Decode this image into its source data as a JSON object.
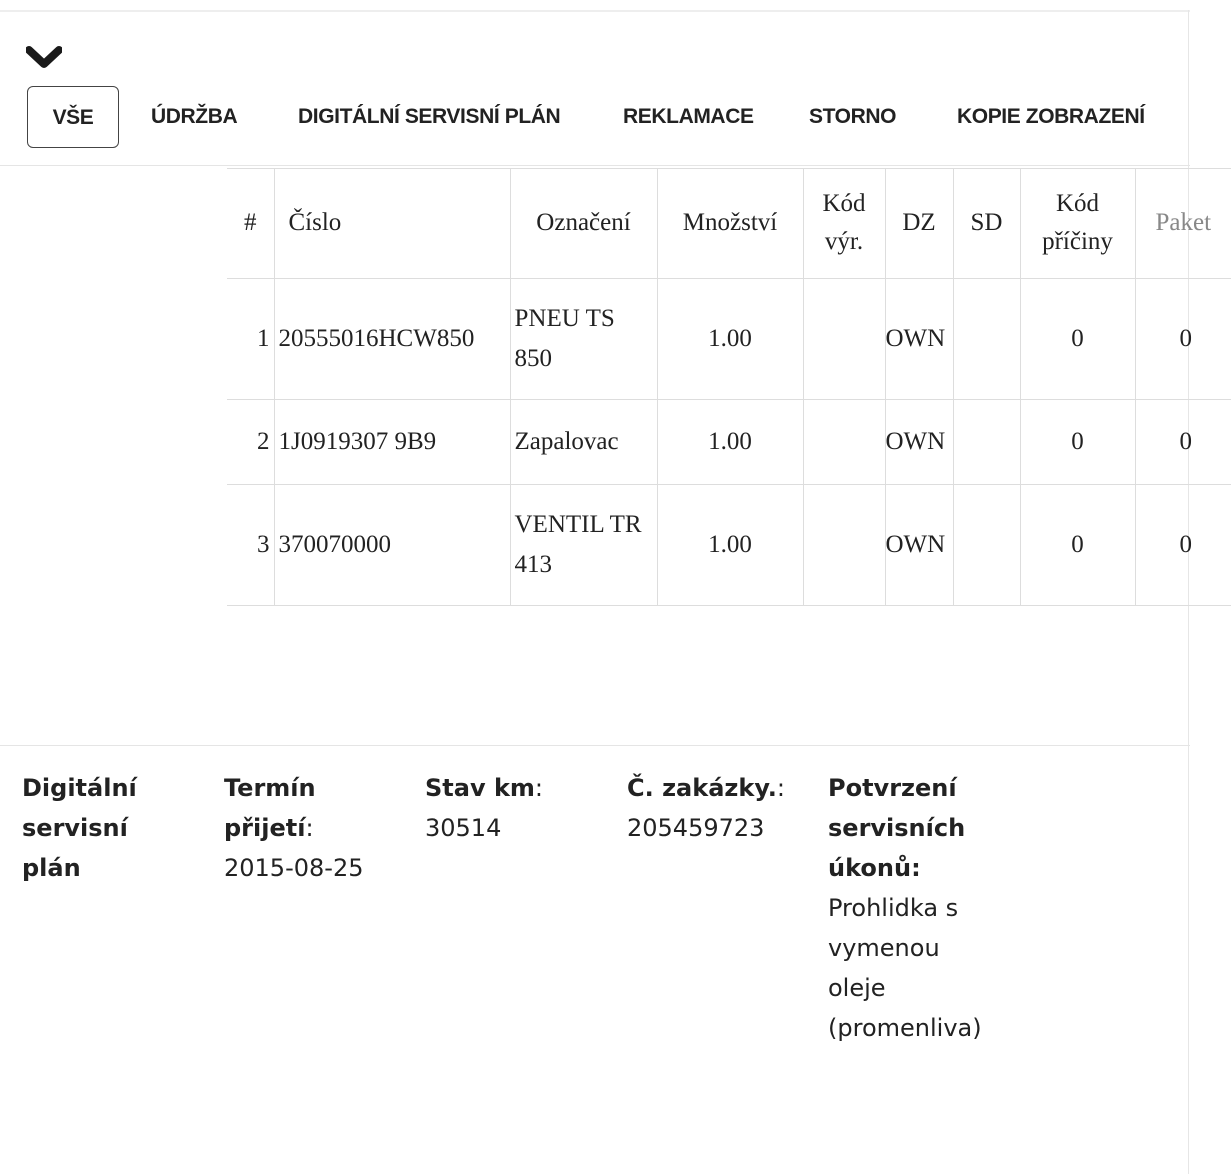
{
  "header": {
    "collapse_icon": "chevron-down-icon",
    "tabs": [
      {
        "label": "VŠE",
        "active": true
      },
      {
        "label": "ÚDRŽBA",
        "active": false
      },
      {
        "label": "DIGITÁLNÍ SERVISNÍ PLÁN",
        "active": false
      },
      {
        "label": "REKLAMACE",
        "active": false
      },
      {
        "label": "STORNO",
        "active": false
      },
      {
        "label": "KOPIE ZOBRAZENÍ",
        "active": false
      }
    ]
  },
  "table": {
    "columns": {
      "num": "#",
      "cislo": "Číslo",
      "oznaceni": "Označení",
      "mnozstvi": "Množství",
      "kod_vyr_1": "Kód",
      "kod_vyr_2": "výr.",
      "dz": "DZ",
      "sd": "SD",
      "kod_priciny_1": "Kód",
      "kod_priciny_2": "příčiny",
      "paket": "Paket"
    },
    "rows": [
      {
        "num": "1",
        "cislo": "20555016HCW850",
        "oznaceni_1": "PNEU TS",
        "oznaceni_2": "850",
        "mnozstvi": "1.00",
        "kod_vyr": "",
        "dz": "OWN",
        "sd": "",
        "kod_priciny": "0",
        "paket": "0"
      },
      {
        "num": "2",
        "cislo": "1J0919307 9B9",
        "oznaceni_1": "Zapalovac",
        "oznaceni_2": "",
        "mnozstvi": "1.00",
        "kod_vyr": "",
        "dz": "OWN",
        "sd": "",
        "kod_priciny": "0",
        "paket": "0"
      },
      {
        "num": "3",
        "cislo": "370070000",
        "oznaceni_1": "VENTIL TR",
        "oznaceni_2": "413",
        "mnozstvi": "1.00",
        "kod_vyr": "",
        "dz": "OWN",
        "sd": "",
        "kod_priciny": "0",
        "paket": "0"
      }
    ]
  },
  "details": {
    "type_1": "Digitální",
    "type_2": "servisní",
    "type_3": "plán",
    "termin_label_1": "Termín",
    "termin_label_2": "přijetí",
    "termin_colon": ":",
    "termin_value": "2015-08-25",
    "stav_label": "Stav km",
    "stav_colon": ":",
    "stav_value": "30514",
    "zakazka_label": "Č. zakázky.",
    "zakazka_colon": ":",
    "zakazka_value": "205459723",
    "potvrzeni_label_1": "Potvrzení",
    "potvrzeni_label_2": "servisních",
    "potvrzeni_label_3": "úkonů:",
    "potvrzeni_value_1": "Prohlidka s",
    "potvrzeni_value_2": "vymenou",
    "potvrzeni_value_3": "oleje",
    "potvrzeni_value_4": "(promenliva)"
  }
}
